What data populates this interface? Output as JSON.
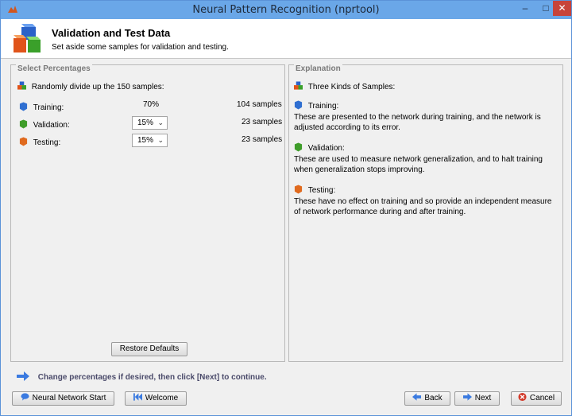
{
  "window": {
    "title": "Neural Pattern Recognition (nprtool)",
    "min_glyph": "–",
    "max_glyph": "□",
    "close_glyph": "✕"
  },
  "header": {
    "title": "Validation and Test Data",
    "subtitle": "Set aside some samples for validation and testing."
  },
  "left_panel": {
    "label": "Select Percentages",
    "intro": "Randomly divide up the 150 samples:",
    "rows": [
      {
        "label": "Training:",
        "percent": "70%",
        "samples": "104 samples",
        "icon": "blue-cube-icon"
      },
      {
        "label": "Validation:",
        "percent": "15%",
        "samples": "23 samples",
        "icon": "green-cube-icon"
      },
      {
        "label": "Testing:",
        "percent": "15%",
        "samples": "23 samples",
        "icon": "orange-cube-icon"
      }
    ],
    "restore_button": "Restore Defaults"
  },
  "right_panel": {
    "label": "Explanation",
    "intro": "Three Kinds of Samples:",
    "sections": [
      {
        "title": "Training:",
        "text": "These are presented to the network during training, and the network is adjusted according to its error."
      },
      {
        "title": "Validation:",
        "text": "These are used to measure network generalization, and to halt training when generalization stops improving."
      },
      {
        "title": "Testing:",
        "text": "These have no effect on training and so provide an independent measure of network performance during and after training."
      }
    ]
  },
  "hint": "Change percentages if desired, then click [Next] to continue.",
  "footer": {
    "nn_start": "Neural Network Start",
    "welcome": "Welcome",
    "back": "Back",
    "next": "Next",
    "cancel": "Cancel"
  },
  "colors": {
    "titlebar": "#6aa7e8",
    "training": "#2f6fd1",
    "validation": "#3f9d2a",
    "testing": "#e06a1e",
    "cancel": "#d23a2a"
  }
}
